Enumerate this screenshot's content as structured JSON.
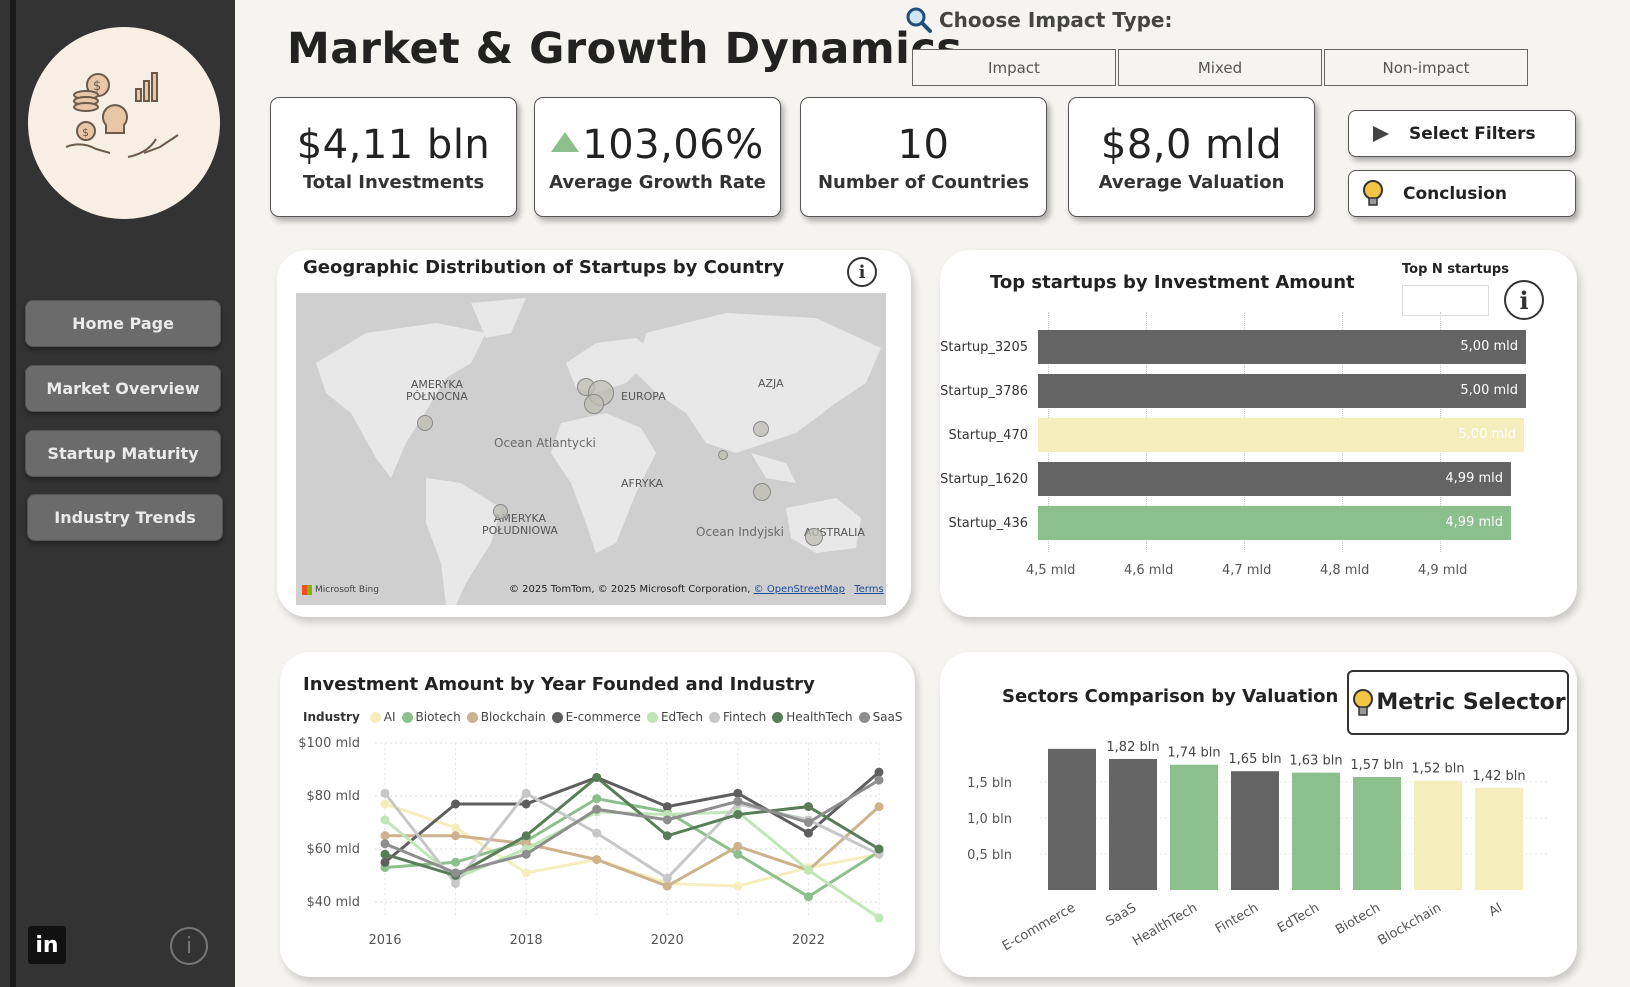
{
  "header": {
    "title": "Market & Growth Dynamics",
    "impact_label": "Choose Impact Type:",
    "impact_options": [
      "Impact",
      "Mixed",
      "Non-impact"
    ]
  },
  "sidebar": {
    "items": [
      {
        "label": "Home Page"
      },
      {
        "label": "Market Overview"
      },
      {
        "label": "Startup Maturity"
      },
      {
        "label": "Industry Trends"
      }
    ],
    "linkedin": "in",
    "info": "i"
  },
  "kpis": [
    {
      "value": "$4,11 bln",
      "label": "Total Investments"
    },
    {
      "value": "103,06%",
      "label": "Average Growth Rate"
    },
    {
      "value": "10",
      "label": "Number of Countries"
    },
    {
      "value": "$8,0 mld",
      "label": "Average Valuation"
    }
  ],
  "actions": {
    "select_filters": "Select Filters",
    "conclusion": "Conclusion"
  },
  "map_panel": {
    "title": "Geographic Distribution of Startups by Country",
    "labels": {
      "north_america": "AMERYKA\nPÓŁNOCNA",
      "europe": "EUROPA",
      "asia": "AZJA",
      "africa": "AFRYKA",
      "south_america": "AMERYKA\nPOŁUDNIOWA",
      "australia": "AUSTRALIA",
      "atlantic": "Ocean Atlantycki",
      "indian": "Ocean Indyjski"
    },
    "bing": "Microsoft Bing",
    "copyright": "© 2025 TomTom, © 2025 Microsoft Corporation,",
    "osm": "© OpenStreetMap",
    "terms": "Terms"
  },
  "top_panel": {
    "title": "Top  startups by Investment Amount",
    "topn_label": "Top N startups"
  },
  "line_panel": {
    "title": "Investment Amount by Year Founded and Industry",
    "legend_title": "Industry"
  },
  "sector_panel": {
    "title": "Sectors Comparison by Valuation",
    "metric_selector": "Metric Selector"
  },
  "colors": {
    "dark": "#646464",
    "green": "#8bbf8b",
    "yellow": "#f5eebc",
    "sidebar": "#333333"
  },
  "chart_data": [
    {
      "type": "bar",
      "orientation": "horizontal",
      "title": "Top  startups by Investment Amount",
      "categories": [
        "Startup_3205",
        "Startup_3786",
        "Startup_470",
        "Startup_1620",
        "Startup_436"
      ],
      "values": [
        5.0,
        5.0,
        5.0,
        4.99,
        4.99
      ],
      "labels": [
        "5,00 mld",
        "5,00 mld",
        "5,00 mld",
        "4,99 mld",
        "4,99 mld"
      ],
      "colors": [
        "#646464",
        "#646464",
        "#f5eebc",
        "#646464",
        "#8bbf8b"
      ],
      "xticks": [
        "4,5 mld",
        "4,6 mld",
        "4,7 mld",
        "4,8 mld",
        "4,9 mld"
      ],
      "xlim": [
        4.5,
        5.0
      ]
    },
    {
      "type": "line",
      "title": "Investment Amount by Year Founded and Industry",
      "x": [
        2016,
        2017,
        2018,
        2019,
        2020,
        2021,
        2022,
        2023
      ],
      "xticks": [
        "2016",
        "2018",
        "2020",
        "2022"
      ],
      "yticks": [
        "$40 mld",
        "$60 mld",
        "$80 mld",
        "$100 mld"
      ],
      "ylim": [
        35,
        100
      ],
      "series": [
        {
          "name": "AI",
          "color": "#f5eebc",
          "values": [
            77,
            68,
            51,
            56,
            47,
            46,
            53,
            58
          ]
        },
        {
          "name": "Biotech",
          "color": "#8bbf8b",
          "values": [
            53,
            55,
            63,
            79,
            74,
            58,
            42,
            59
          ]
        },
        {
          "name": "Blockchain",
          "color": "#cdb28d",
          "values": [
            65,
            65,
            62,
            56,
            46,
            61,
            52,
            76
          ]
        },
        {
          "name": "E-commerce",
          "color": "#5e5e5e",
          "values": [
            55,
            77,
            77,
            87,
            76,
            81,
            66,
            89
          ]
        },
        {
          "name": "EdTech",
          "color": "#bfe6b6",
          "values": [
            71,
            49,
            60,
            74,
            73,
            74,
            52,
            34
          ]
        },
        {
          "name": "Fintech",
          "color": "#c7c7c7",
          "values": [
            81,
            47,
            81,
            66,
            49,
            77,
            71,
            58
          ]
        },
        {
          "name": "HealthTech",
          "color": "#587d58",
          "values": [
            58,
            50,
            65,
            87,
            65,
            73,
            76,
            60
          ]
        },
        {
          "name": "SaaS",
          "color": "#8e8e8e",
          "values": [
            62,
            51,
            58,
            75,
            71,
            78,
            70,
            86
          ]
        }
      ]
    },
    {
      "type": "bar",
      "title": "Sectors Comparison by Valuation",
      "categories": [
        "E-commerce",
        "SaaS",
        "HealthTech",
        "Fintech",
        "EdTech",
        "Biotech",
        "Blockchain",
        "AI"
      ],
      "values": [
        1.96,
        1.82,
        1.74,
        1.65,
        1.63,
        1.57,
        1.52,
        1.42
      ],
      "labels": [
        "",
        "1,82 bln",
        "1,74 bln",
        "1,65 bln",
        "1,63 bln",
        "1,57 bln",
        "1,52 bln",
        "1,42 bln"
      ],
      "colors": [
        "#646464",
        "#646464",
        "#8bbf8b",
        "#646464",
        "#8bbf8b",
        "#8bbf8b",
        "#f5eebc",
        "#f5eebc"
      ],
      "yticks": [
        "0,5 bln",
        "1,0 bln",
        "1,5 bln"
      ],
      "ylim": [
        0,
        2.0
      ]
    }
  ]
}
